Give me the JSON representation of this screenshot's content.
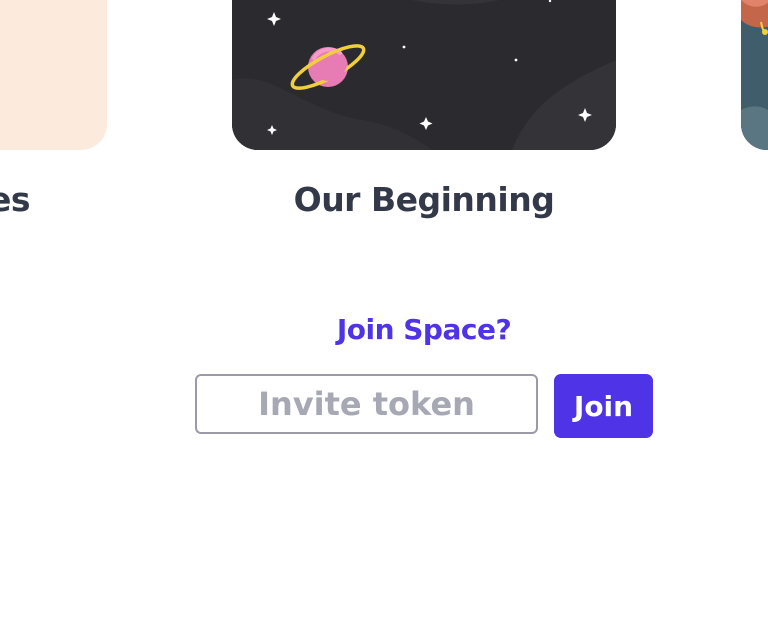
{
  "spaces": [
    {
      "title": "Memories",
      "visible_title": "ies",
      "art": "peach-card",
      "color": "#fcebdd"
    },
    {
      "title": "Our Beginning",
      "art": "space-planet-illustration",
      "color": "#2b2b2f"
    },
    {
      "title": "",
      "art": "portrait-illustration",
      "color": "#3f5d6b"
    }
  ],
  "join": {
    "heading": "Join Space?",
    "input_placeholder": "Invite token",
    "input_value": "",
    "button_label": "Join"
  },
  "colors": {
    "accent": "#4f33e6",
    "title_text": "#34394a",
    "input_border": "#9a9ba6",
    "placeholder": "#a6a8b4"
  }
}
